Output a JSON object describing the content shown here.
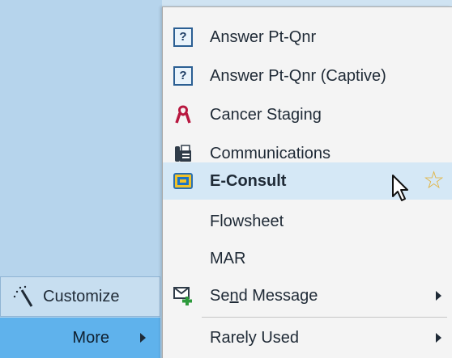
{
  "sidebar": {
    "customize_label": "Customize",
    "more_label": "More"
  },
  "menu": {
    "items": [
      {
        "label": "Answer Pt-Qnr",
        "icon": "questionnaire-icon"
      },
      {
        "label": "Answer Pt-Qnr (Captive)",
        "icon": "questionnaire-icon"
      },
      {
        "label": "Cancer Staging",
        "icon": "cancer-ribbon-icon"
      },
      {
        "label": "Communications",
        "icon": "fax-icon"
      },
      {
        "label": "E-Consult",
        "icon": "econsult-phone-icon",
        "selected": true,
        "favorite": true
      },
      {
        "label": "Flowsheet",
        "icon": ""
      },
      {
        "label": "MAR",
        "icon": ""
      },
      {
        "label": "Send Message",
        "icon": "send-message-icon",
        "has_submenu": true,
        "mnemonic": "n"
      },
      {
        "label": "Rarely Used",
        "icon": "",
        "has_submenu": true
      }
    ]
  },
  "colors": {
    "sidebar_bg": "#b6d4ec",
    "more_bg": "#5fb2ec",
    "selected_bg": "#d5e8f6",
    "star": "#e2b23d"
  }
}
